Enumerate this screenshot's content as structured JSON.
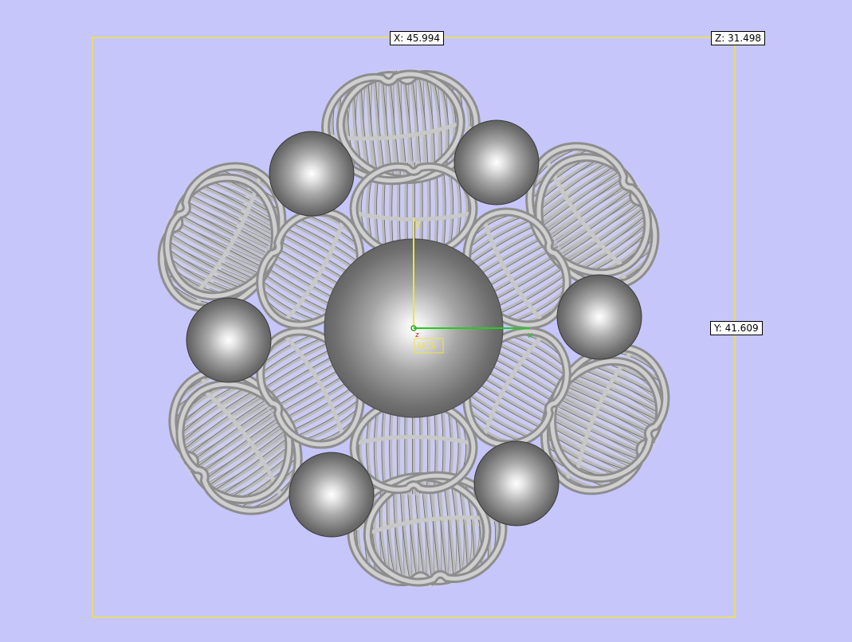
{
  "viewport": {
    "background_color": "#c6c6fa",
    "bounding_box_color": "#f0e442"
  },
  "dimensions": {
    "x_label": "X: 45.994",
    "y_label": "Y: 41.609",
    "z_label": "Z: 31.498"
  },
  "axes": {
    "y_axis_label": "y",
    "x_axis_label": "x",
    "z_axis_label": "z",
    "ucs_label": "UCS",
    "x_color": "#22cc22",
    "y_color": "#f0e442",
    "z_color": "#cc2222"
  },
  "model": {
    "name_icon": "flower-lattice-model",
    "center_sphere_count": 1,
    "petal_sphere_count": 6
  }
}
